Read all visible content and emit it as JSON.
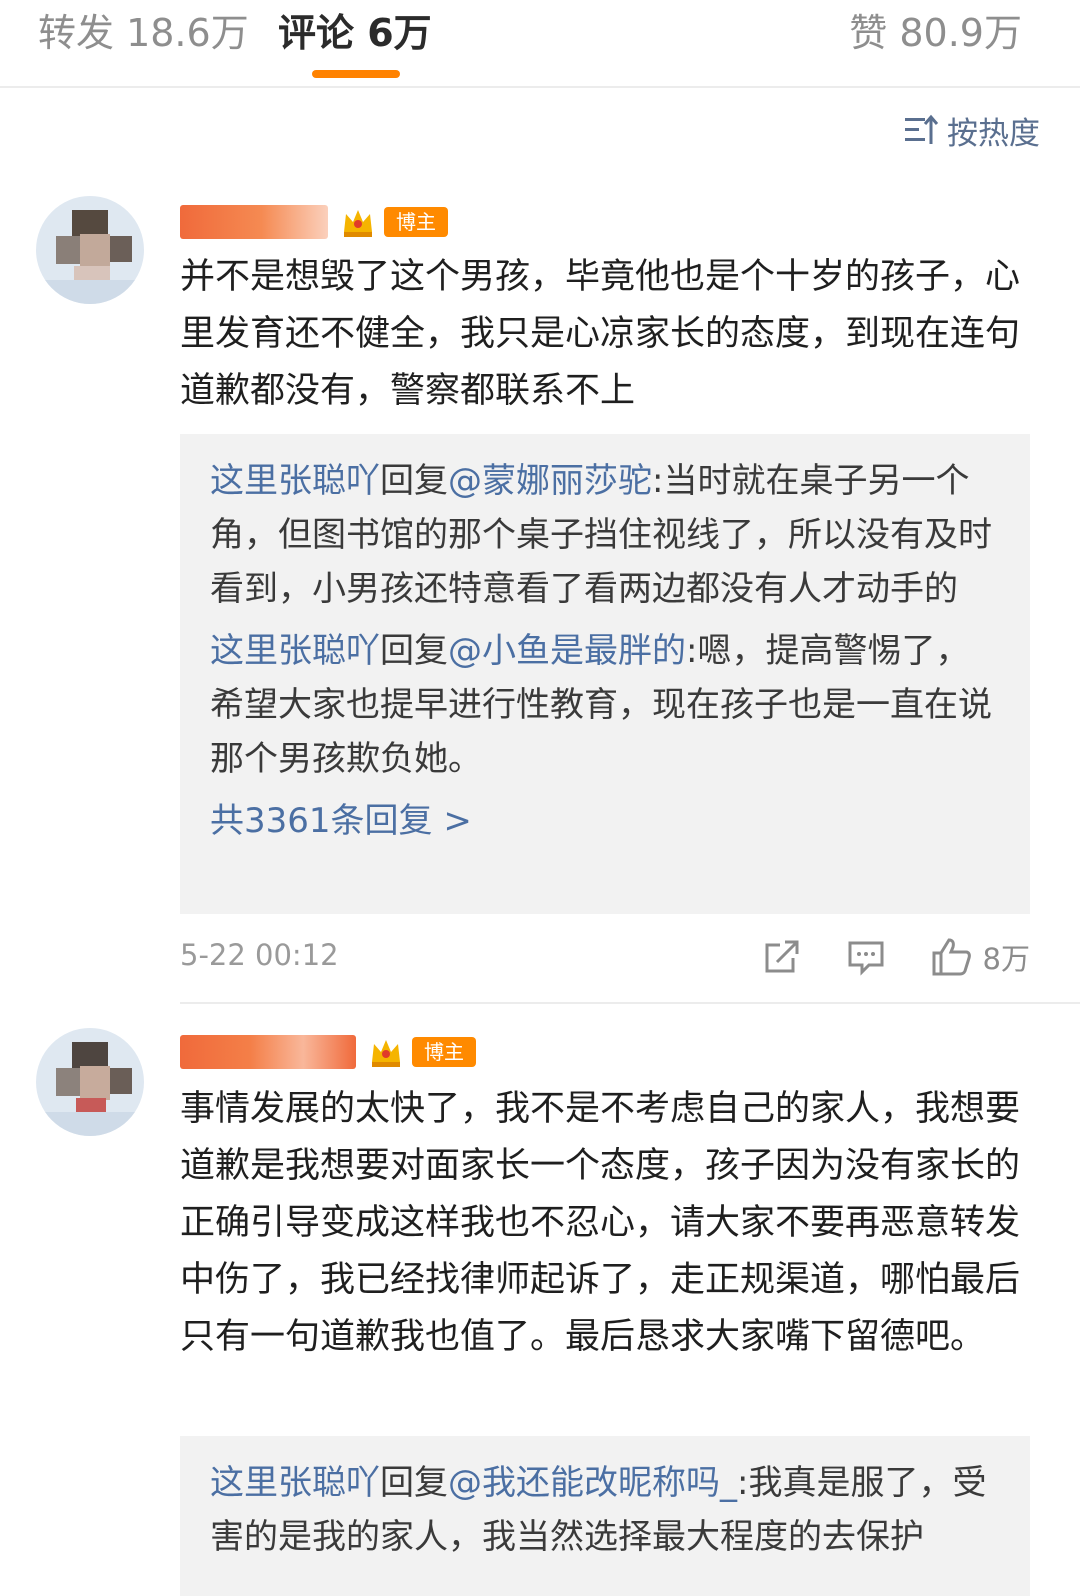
{
  "tabs": [
    {
      "label": "转发 18.6万"
    },
    {
      "label": "评论 6万"
    },
    {
      "label": "赞 80.9万"
    }
  ],
  "sort": {
    "label": "按热度"
  },
  "comments": [
    {
      "author_badge": "博主",
      "text": "并不是想毁了这个男孩，毕竟他也是个十岁的孩子，心里发育还不健全，我只是心凉家长的态度，到现在连句道歉都没有，警察都联系不上",
      "replies": [
        {
          "user": "这里张聪吖",
          "verb": "回复",
          "target": "@蒙娜丽莎驼",
          "text": ":当时就在桌子另一个角，但图书馆的那个桌子挡住视线了，所以没有及时看到，小男孩还特意看了看两边都没有人才动手的"
        },
        {
          "user": "这里张聪吖",
          "verb": "回复",
          "target": "@小鱼是最胖的",
          "text": ":嗯，提高警惕了，希望大家也提早进行性教育，现在孩子也是一直在说那个男孩欺负她。"
        }
      ],
      "more": "共3361条回复 >",
      "time": "5-22 00:12",
      "likes": "8万"
    },
    {
      "author_badge": "博主",
      "text": "事情发展的太快了，我不是不考虑自己的家人，我想要道歉是我想要对面家长一个态度，孩子因为没有家长的正确引导变成这样我也不忍心，请大家不要再恶意转发中伤了，我已经找律师起诉了，走正规渠道，哪怕最后只有一句道歉我也值了。最后恳求大家嘴下留德吧。",
      "replies": [
        {
          "user": "这里张聪吖",
          "verb": "回复",
          "target": "@我还能改昵称吗_",
          "text": ":我真是服了，受害的是我的家人，我当然选择最大程度的去保护"
        }
      ]
    }
  ],
  "colors": {
    "accent": "#ff8200",
    "link": "#4b6fa3",
    "badge": "#ff8a00"
  }
}
